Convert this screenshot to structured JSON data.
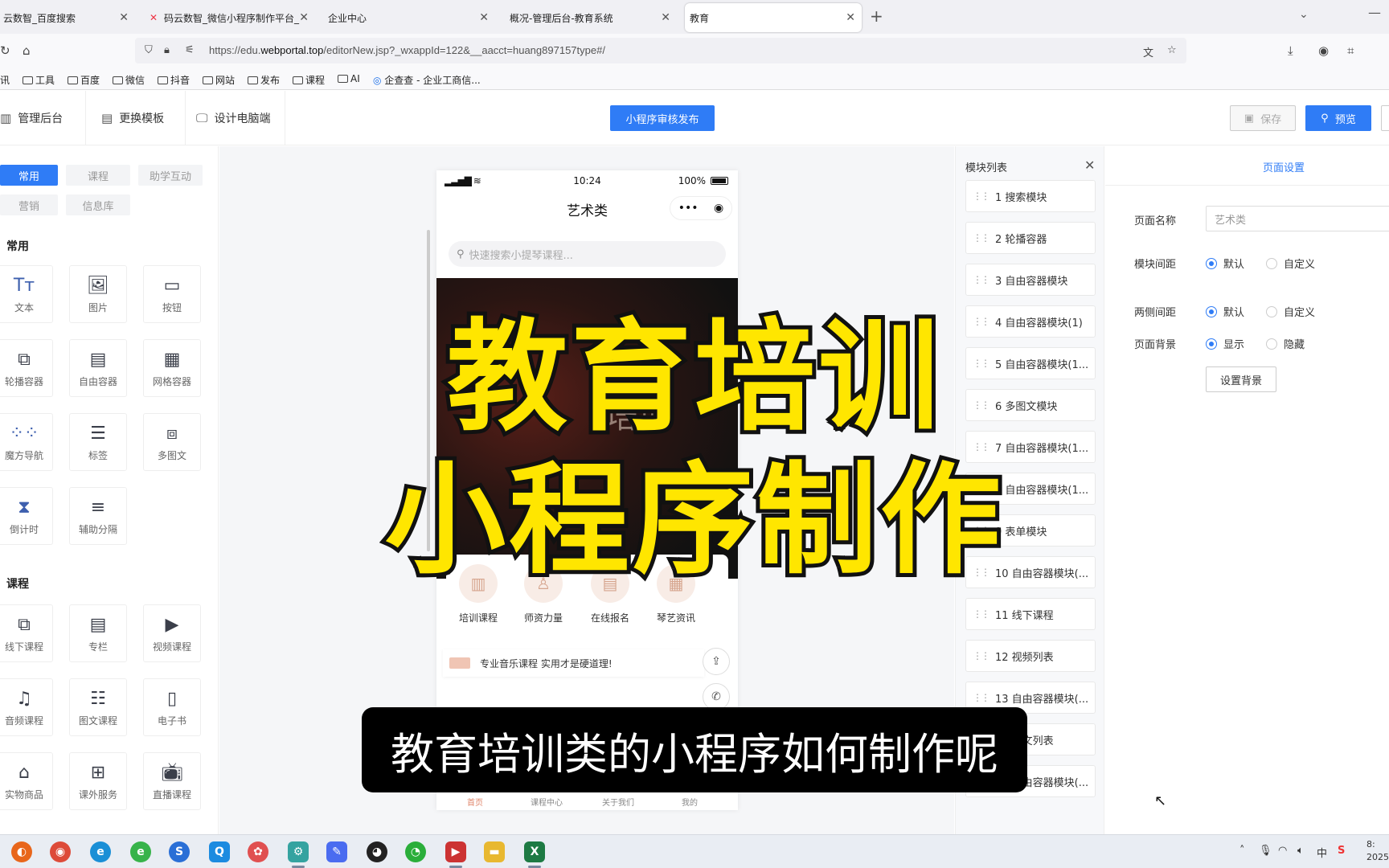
{
  "browser": {
    "tabs": [
      {
        "title": "云数智_百度搜索",
        "active": false
      },
      {
        "title": "码云数智_微信小程序制作平台_",
        "active": false
      },
      {
        "title": "企业中心",
        "active": false
      },
      {
        "title": "概况-管理后台-教育系统",
        "active": false
      },
      {
        "title": "教育",
        "active": true
      }
    ],
    "new_tab": "+",
    "url_prefix": "https://edu.",
    "url_domain": "webportal.top",
    "url_rest": "/editorNew.jsp?_wxappId=122&__aacct=huang897157type#/",
    "bookmarks": [
      "讯",
      "工具",
      "百度",
      "微信",
      "抖音",
      "网站",
      "发布",
      "课程",
      "AI",
      "企查查 - 企业工商信..."
    ]
  },
  "toolbar": {
    "admin_label": "管理后台",
    "template_label": "更换模板",
    "desktop_label": "设计电脑端",
    "publish_label": "小程序审核发布",
    "save_label": "保存",
    "preview_label": "预览"
  },
  "components": {
    "categories": [
      {
        "label": "常用",
        "active": true
      },
      {
        "label": "课程",
        "active": false
      },
      {
        "label": "助学互动",
        "active": false
      },
      {
        "label": "营销",
        "active": false
      },
      {
        "label": "信息库",
        "active": false
      }
    ],
    "common_title": "常用",
    "common": [
      {
        "label": "文本",
        "icon": "text-icon"
      },
      {
        "label": "图片",
        "icon": "image-icon"
      },
      {
        "label": "按钮",
        "icon": "button-icon"
      },
      {
        "label": "轮播容器",
        "icon": "carousel-icon"
      },
      {
        "label": "自由容器",
        "icon": "free-container-icon"
      },
      {
        "label": "网格容器",
        "icon": "grid-icon"
      },
      {
        "label": "魔方导航",
        "icon": "dots-grid-icon"
      },
      {
        "label": "标签",
        "icon": "tabs-icon"
      },
      {
        "label": "多图文",
        "icon": "multi-image-icon"
      },
      {
        "label": "倒计时",
        "icon": "hourglass-icon"
      },
      {
        "label": "辅助分隔",
        "icon": "divider-icon"
      }
    ],
    "course_title": "课程",
    "course": [
      {
        "label": "线下课程",
        "icon": "offline-course-icon"
      },
      {
        "label": "专栏",
        "icon": "column-icon"
      },
      {
        "label": "视频课程",
        "icon": "video-icon"
      },
      {
        "label": "音频课程",
        "icon": "audio-icon"
      },
      {
        "label": "图文课程",
        "icon": "list-icon"
      },
      {
        "label": "电子书",
        "icon": "ebook-icon"
      },
      {
        "label": "实物商品",
        "icon": "shop-icon"
      },
      {
        "label": "课外服务",
        "icon": "service-icon"
      },
      {
        "label": "直播课程",
        "icon": "live-icon"
      }
    ]
  },
  "phone": {
    "time": "10:24",
    "battery": "100%",
    "title": "艺术类",
    "search_placeholder": "快速搜索小提琴课程...",
    "banner_line1": "提琴",
    "banner_line2": "培训",
    "nav_icons": [
      {
        "label": "培训课程"
      },
      {
        "label": "师资力量"
      },
      {
        "label": "在线报名"
      },
      {
        "label": "琴艺资讯"
      }
    ],
    "notice": "专业音乐课程 实用才是硬道理!",
    "tabs": [
      "首页",
      "课程中心",
      "关于我们",
      "我的"
    ]
  },
  "modules": {
    "title": "模块列表",
    "items": [
      "1 搜索模块",
      "2 轮播容器",
      "3 自由容器模块",
      "4 自由容器模块(1)",
      "5 自由容器模块(1...",
      "6 多图文模块",
      "7 自由容器模块(1...",
      "8 自由容器模块(1...",
      "9 表单模块",
      "10 自由容器模块(...",
      "11 线下课程",
      "12 视频列表",
      "13 自由容器模块(...",
      "14 图文列表",
      "15 自由容器模块(..."
    ]
  },
  "settings": {
    "tab": "页面设置",
    "name_label": "页面名称",
    "name_value": "艺术类",
    "spacing_label": "模块间距",
    "side_label": "两侧间距",
    "bg_label": "页面背景",
    "default": "默认",
    "custom": "自定义",
    "show": "显示",
    "hide": "隐藏",
    "set_bg_button": "设置背景"
  },
  "overlay": {
    "line1": "教育培训",
    "line2": "小程序制作",
    "subtitle": "教育培训类的小程序如何制作呢"
  },
  "taskbar": {
    "ime": "中",
    "clock_time": "8:",
    "clock_date": "2025"
  },
  "colors": {
    "accent": "#2f7cf6",
    "overlay_text": "#ffe600",
    "banner_dark": "#2a1512"
  }
}
